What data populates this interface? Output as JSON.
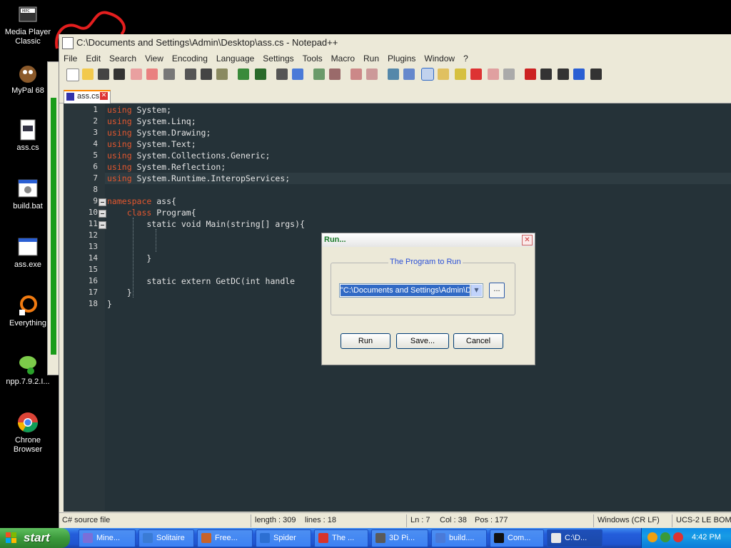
{
  "desktop": {
    "icons": [
      {
        "label": "Media Player Classic",
        "icon": "media-player-icon"
      },
      {
        "label": "MyPal 68",
        "icon": "mypal-browser-icon"
      },
      {
        "label": "ass.cs",
        "icon": "cs-file-icon"
      },
      {
        "label": "build.bat",
        "icon": "batch-file-icon"
      },
      {
        "label": "ass.exe",
        "icon": "exe-file-icon"
      },
      {
        "label": "Everything",
        "icon": "everything-search-icon"
      },
      {
        "label": "npp.7.9.2.I...",
        "icon": "npp-installer-icon"
      },
      {
        "label": "Chrone Browser",
        "icon": "chrome-icon"
      }
    ]
  },
  "notepad": {
    "title": "C:\\Documents and Settings\\Admin\\Desktop\\ass.cs - Notepad++",
    "menu": [
      "File",
      "Edit",
      "Search",
      "View",
      "Encoding",
      "Language",
      "Settings",
      "Tools",
      "Macro",
      "Run",
      "Plugins",
      "Window",
      "?"
    ],
    "tab": {
      "label": "ass.cs"
    },
    "code_lines": [
      {
        "n": "1",
        "kw": "using",
        "rest": " System;"
      },
      {
        "n": "2",
        "kw": "using",
        "rest": " System.Linq;"
      },
      {
        "n": "3",
        "kw": "using",
        "rest": " System.Drawing;"
      },
      {
        "n": "4",
        "kw": "using",
        "rest": " System.Text;"
      },
      {
        "n": "5",
        "kw": "using",
        "rest": " System.Collections.Generic;"
      },
      {
        "n": "6",
        "kw": "using",
        "rest": " System.Reflection;"
      },
      {
        "n": "7",
        "kw": "using",
        "rest": " System.Runtime.InteropServices;"
      },
      {
        "n": "8",
        "kw": "",
        "rest": ""
      },
      {
        "n": "9",
        "kw": "namespace",
        "rest": " ass{"
      },
      {
        "n": "10",
        "kw": "    class",
        "rest": " Program{"
      },
      {
        "n": "11",
        "kw": "",
        "rest": "        static void Main(string[] args){"
      },
      {
        "n": "12",
        "kw": "",
        "rest": ""
      },
      {
        "n": "13",
        "kw": "",
        "rest": ""
      },
      {
        "n": "14",
        "kw": "",
        "rest": "        }"
      },
      {
        "n": "15",
        "kw": "",
        "rest": ""
      },
      {
        "n": "16",
        "kw": "",
        "rest": "        static extern GetDC(int handle"
      },
      {
        "n": "17",
        "kw": "",
        "rest": "    }"
      },
      {
        "n": "18",
        "kw": "",
        "rest": "}"
      }
    ],
    "status": {
      "filetype": "C# source file",
      "length": "length : 309",
      "lines": "lines : 18",
      "ln": "Ln : 7",
      "col": "Col : 38",
      "pos": "Pos : 177",
      "eol": "Windows (CR LF)",
      "encoding": "UCS-2 LE BOM"
    }
  },
  "run_dialog": {
    "title": "Run...",
    "group_label": "The Program to Run",
    "command_value": "\"C:\\Documents and Settings\\Admin\\D",
    "browse_label": "...",
    "run_label": "Run",
    "save_label": "Save...",
    "cancel_label": "Cancel"
  },
  "taskbar": {
    "start_label": "start",
    "tasks": [
      {
        "label": "Mine...",
        "color": "#7a6fd8"
      },
      {
        "label": "Solitaire",
        "color": "#3a7bd5"
      },
      {
        "label": "Free...",
        "color": "#c8632a"
      },
      {
        "label": "Spider",
        "color": "#2c6fd2"
      },
      {
        "label": "The ...",
        "color": "#d8342a"
      },
      {
        "label": "3D Pi...",
        "color": "#5a5a5a"
      },
      {
        "label": "build....",
        "color": "#4a7ad8"
      },
      {
        "label": "Com...",
        "color": "#111111"
      },
      {
        "label": "C:\\D...",
        "color": "#e8e8e8"
      }
    ],
    "clock": "4:42 PM"
  }
}
